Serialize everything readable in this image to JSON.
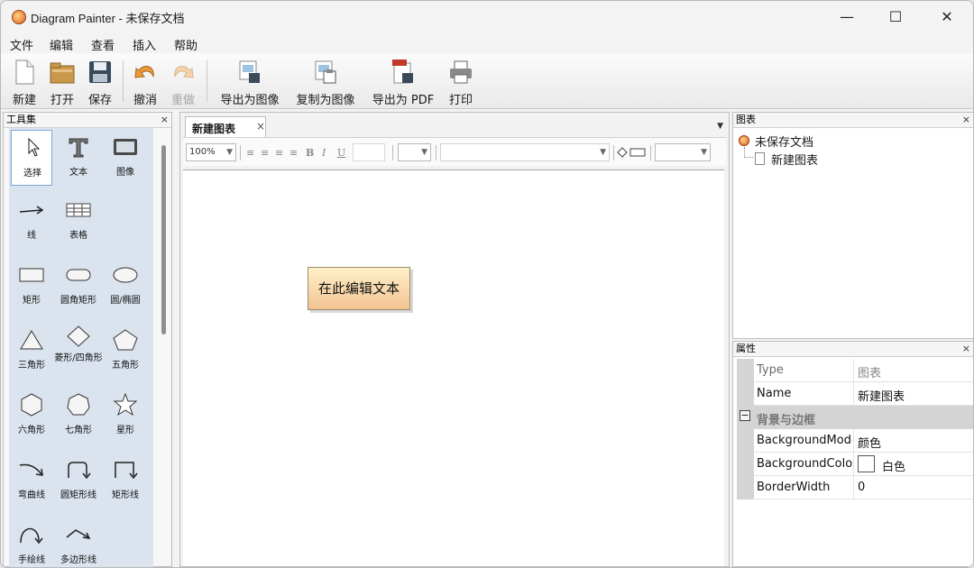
{
  "window": {
    "title": "Diagram Painter - 未保存文档",
    "min_glyph": "—",
    "max_glyph": "☐",
    "close_glyph": "✕"
  },
  "menubar": [
    "文件",
    "编辑",
    "查看",
    "插入",
    "帮助"
  ],
  "toolbar": {
    "new": "新建",
    "open": "打开",
    "save": "保存",
    "undo": "撤消",
    "redo": "重做",
    "export_image": "导出为图像",
    "copy_image": "复制为图像",
    "export_pdf": "导出为 PDF",
    "print": "打印"
  },
  "toolbox": {
    "title": "工具集",
    "close": "×",
    "tools": [
      {
        "label": "选择",
        "icon": "pointer-icon",
        "selected": true
      },
      {
        "label": "文本",
        "icon": "text-tool-icon"
      },
      {
        "label": "图像",
        "icon": "image-tool-icon"
      },
      {
        "label": "线",
        "icon": "line-tool-icon"
      },
      {
        "label": "表格",
        "icon": "table-tool-icon"
      },
      {
        "label": "矩形",
        "icon": "rectangle-icon"
      },
      {
        "label": "圆角矩形",
        "icon": "rounded-rectangle-icon"
      },
      {
        "label": "圆/椭圆",
        "icon": "ellipse-icon"
      },
      {
        "label": "三角形",
        "icon": "triangle-icon"
      },
      {
        "label": "菱形/四角形",
        "icon": "diamond-icon"
      },
      {
        "label": "五角形",
        "icon": "pentagon-icon"
      },
      {
        "label": "六角形",
        "icon": "hexagon-icon"
      },
      {
        "label": "七角形",
        "icon": "heptagon-icon"
      },
      {
        "label": "星形",
        "icon": "star-icon"
      },
      {
        "label": "弯曲线",
        "icon": "curved-line-icon"
      },
      {
        "label": "圆矩形线",
        "icon": "rounded-elbow-line-icon"
      },
      {
        "label": "矩形线",
        "icon": "elbow-line-icon"
      },
      {
        "label": "手绘线",
        "icon": "freehand-line-icon"
      },
      {
        "label": "多边形线",
        "icon": "polyline-icon"
      }
    ]
  },
  "editor": {
    "tab_label": "新建图表",
    "tab_close": "×",
    "zoom_value": "100%",
    "format_glyphs": [
      "≡",
      "≡",
      "≡",
      "≡",
      "B",
      "I",
      "U"
    ],
    "canvas_text": "在此编辑文本"
  },
  "chart_panel": {
    "title": "图表",
    "close": "×",
    "root_label": "未保存文档",
    "child_label": "新建图表"
  },
  "props_panel": {
    "title": "属性",
    "close": "×",
    "rows": [
      {
        "name": "Type",
        "value": "图表"
      },
      {
        "name": "Name",
        "value": "新建图表"
      }
    ],
    "category": {
      "toggle": "−",
      "label": "背景与边框"
    },
    "bg_rows": [
      {
        "name": "BackgroundMode",
        "value": "颜色"
      },
      {
        "name": "BackgroundColor",
        "value": "白色"
      },
      {
        "name": "BorderWidth",
        "value": "0"
      }
    ]
  }
}
